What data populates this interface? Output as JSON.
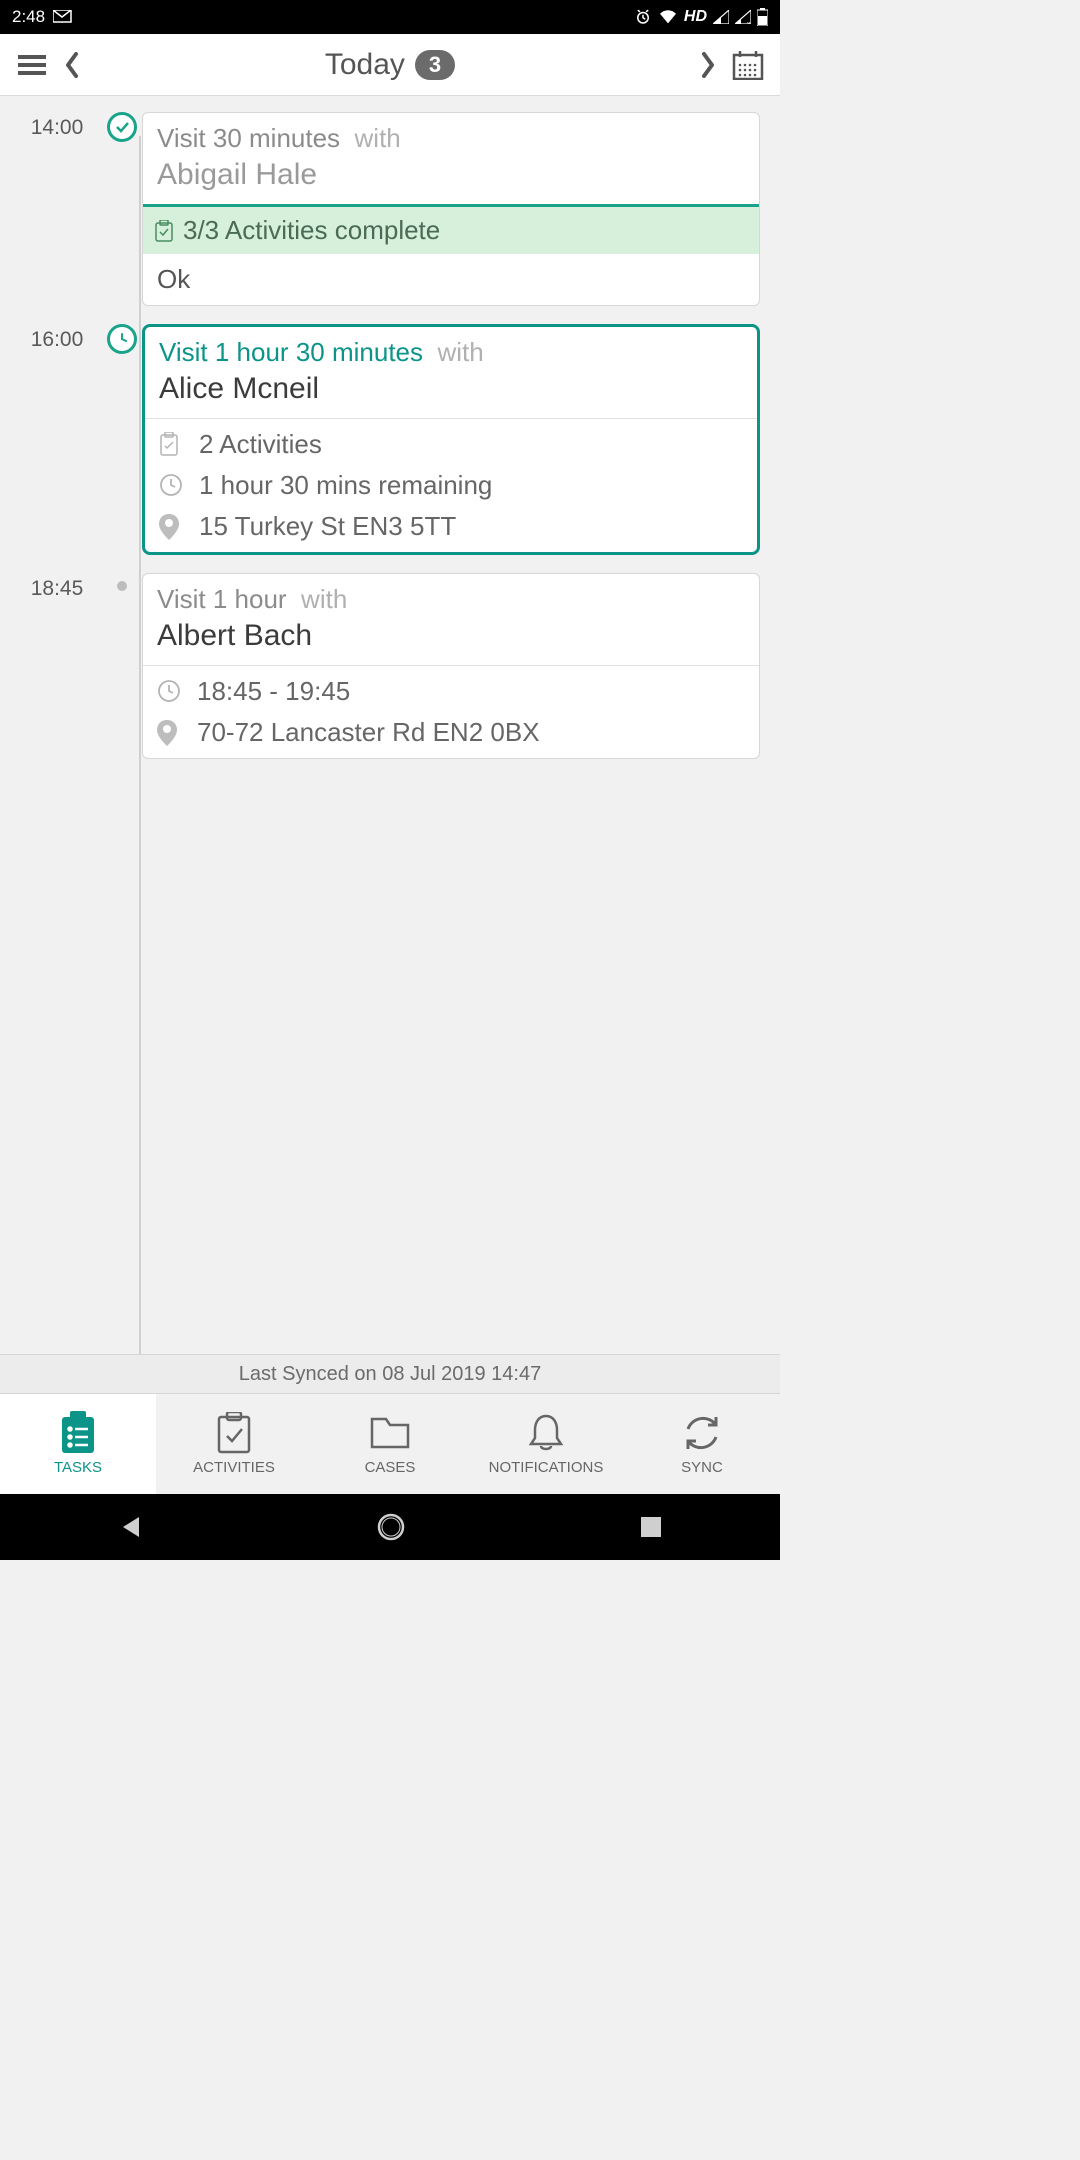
{
  "status": {
    "time": "2:48",
    "hd": "HD"
  },
  "header": {
    "title": "Today",
    "badge": "3"
  },
  "visits": [
    {
      "time": "14:00",
      "title": "Visit 30 minutes",
      "with": "with",
      "person": "Abigail Hale",
      "activities_status": "3/3 Activities complete",
      "note": "Ok"
    },
    {
      "time": "16:00",
      "title": "Visit 1 hour 30 minutes",
      "with": "with",
      "person": "Alice Mcneil",
      "activities": "2 Activities",
      "remaining": "1 hour 30 mins remaining",
      "address": "15 Turkey St  EN3 5TT"
    },
    {
      "time": "18:45",
      "title": "Visit 1 hour",
      "with": "with",
      "person": "Albert Bach",
      "window": "18:45 - 19:45",
      "address": "70-72 Lancaster Rd  EN2 0BX"
    }
  ],
  "sync": "Last Synced on 08 Jul 2019 14:47",
  "tabs": {
    "tasks": "TASKS",
    "activities": "ACTIVITIES",
    "cases": "CASES",
    "notifications": "NOTIFICATIONS",
    "sync": "SYNC"
  }
}
